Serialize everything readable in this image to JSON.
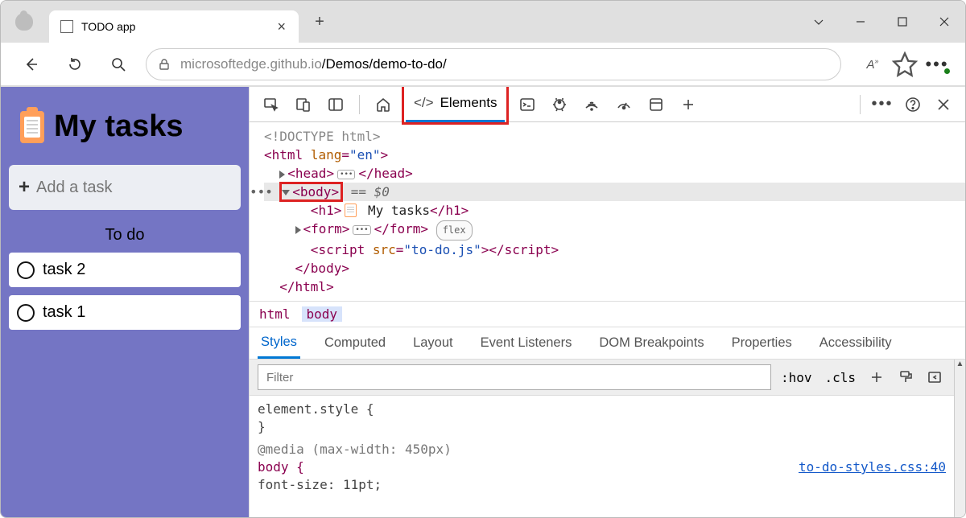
{
  "browser": {
    "tab_title": "TODO app",
    "url_gray_left": "microsoftedge.github.io",
    "url_rest": "/Demos/demo-to-do/",
    "reading_label": "A",
    "aa_sup": "»"
  },
  "page": {
    "heading": "My tasks",
    "add_placeholder": "Add a task",
    "section": "To do",
    "tasks": [
      "task 2",
      "task 1"
    ]
  },
  "devtools": {
    "elements_label": "Elements",
    "dom": {
      "doctype": "<!DOCTYPE html>",
      "html_open": "html",
      "lang_attr": "lang",
      "lang_val": "\"en\"",
      "head": "head",
      "body": "body",
      "eq0": " == $0",
      "h1_open": "h1",
      "h1_text": " My tasks",
      "form": "form",
      "flex_badge": "flex",
      "script": "script",
      "src_attr": "src",
      "src_val": "\"to-do.js\"",
      "html_close": "html"
    },
    "breadcrumb": [
      "html",
      "body"
    ],
    "side_tabs": [
      "Styles",
      "Computed",
      "Layout",
      "Event Listeners",
      "DOM Breakpoints",
      "Properties",
      "Accessibility"
    ],
    "filter_placeholder": "Filter",
    "hov": ":hov",
    "cls": ".cls",
    "styles": {
      "element_style": "element.style {",
      "close": "}",
      "media": "@media (max-width: 450px)",
      "body_open": "body {",
      "font_size": "  font-size: 11pt;",
      "css_link": "to-do-styles.css:40"
    }
  }
}
